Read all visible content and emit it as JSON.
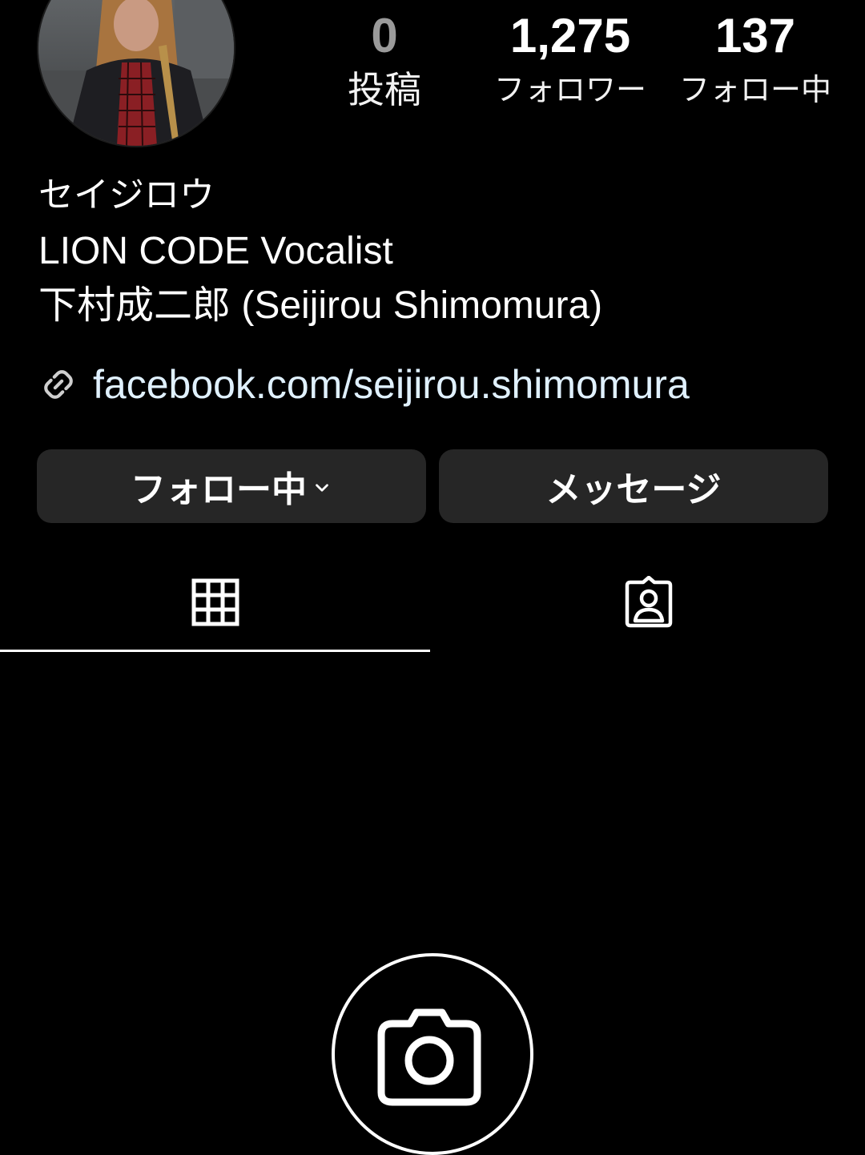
{
  "profile": {
    "avatar_icon": "profile-photo",
    "stats": {
      "posts": {
        "value": "0",
        "label": "投稿"
      },
      "followers": {
        "value": "1,275",
        "label": "フォロワー"
      },
      "following": {
        "value": "137",
        "label": "フォロー中"
      }
    },
    "bio": {
      "name": "セイジロウ",
      "line1": "LION CODE Vocalist",
      "line2": "下村成二郎 (Seijirou Shimomura)"
    },
    "link": {
      "icon": "link-icon",
      "text": "facebook.com/seijirou.shimomura"
    }
  },
  "actions": {
    "following_label": "フォロー中",
    "following_icon": "chevron-down-icon",
    "message_label": "メッセージ"
  },
  "tabs": [
    {
      "icon": "grid-icon",
      "active": true
    },
    {
      "icon": "tagged-person-icon",
      "active": false
    }
  ],
  "empty_state": {
    "icon": "camera-icon"
  },
  "colors": {
    "background": "#000000",
    "button_bg": "#262626",
    "text": "#ffffff",
    "link_text": "#e0f1ff",
    "dim_count": "#9a9a9a"
  }
}
